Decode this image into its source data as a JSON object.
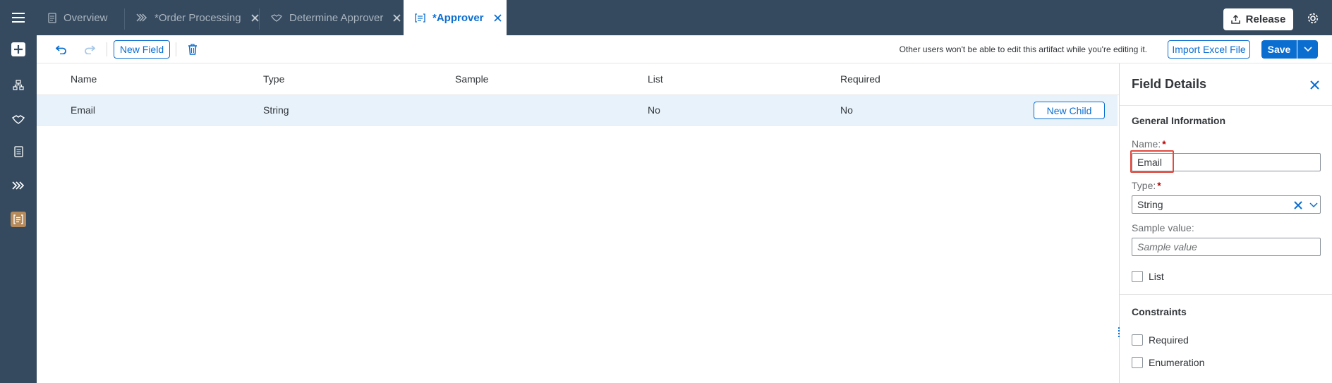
{
  "shell": {
    "menu_icon": "hamburger-icon",
    "tabs": [
      {
        "label": "Overview",
        "icon": "document-icon",
        "closable": false
      },
      {
        "label": "*Order Processing",
        "icon": "process-icon",
        "closable": true
      },
      {
        "label": "Determine Approver",
        "icon": "handshake-icon",
        "closable": true
      },
      {
        "label": "*Approver",
        "icon": "datatype-icon",
        "closable": true,
        "active": true
      }
    ],
    "release_label": "Release",
    "settings_icon": "gear-icon"
  },
  "sidebar": {
    "items": [
      {
        "icon": "add-icon"
      },
      {
        "icon": "hierarchy-icon"
      },
      {
        "icon": "handshake-icon"
      },
      {
        "icon": "form-icon"
      },
      {
        "icon": "process-icon"
      },
      {
        "icon": "datatype-icon",
        "active": true
      }
    ]
  },
  "toolbar": {
    "undo_icon": "undo-icon",
    "redo_icon": "redo-icon",
    "new_field_label": "New Field",
    "delete_icon": "trash-icon",
    "notice": "Other users won't be able to edit this artifact while you're editing it.",
    "import_label": "Import Excel File",
    "save_label": "Save"
  },
  "table": {
    "headers": [
      "Name",
      "Type",
      "Sample",
      "List",
      "Required"
    ],
    "rows": [
      {
        "name": "Email",
        "type": "String",
        "sample": "",
        "list": "No",
        "required": "No",
        "action": "New Child"
      }
    ]
  },
  "details": {
    "title": "Field Details",
    "general_title": "General Information",
    "name_label": "Name:",
    "name_value": "Email",
    "type_label": "Type:",
    "type_value": "String",
    "sample_label": "Sample value:",
    "sample_placeholder": "Sample value",
    "list_label": "List",
    "constraints_title": "Constraints",
    "required_label": "Required",
    "enumeration_label": "Enumeration",
    "required_marker": "*"
  },
  "colors": {
    "shell": "#354a5f",
    "accent": "#0a6ed1",
    "selected_row": "#e8f2fb",
    "highlight": "#e04a3f"
  }
}
